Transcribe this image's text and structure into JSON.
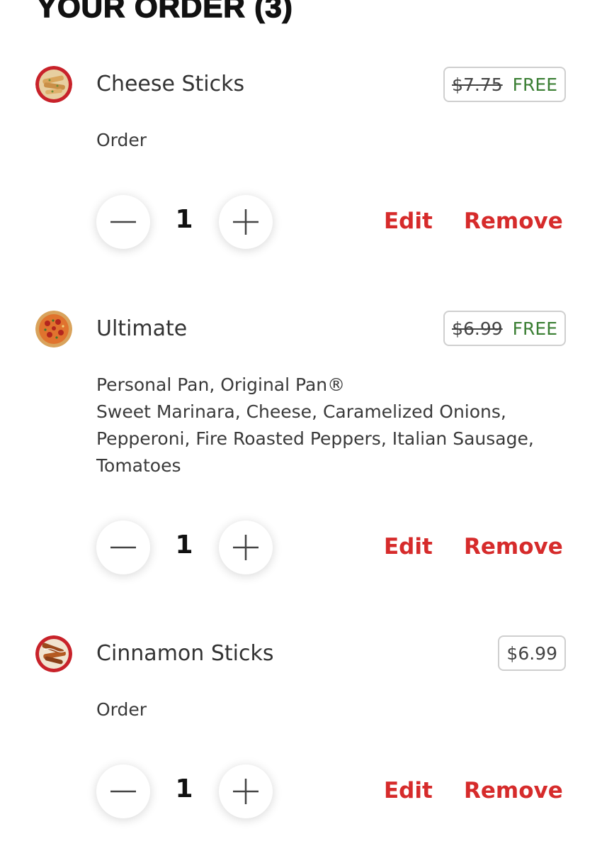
{
  "order": {
    "title": "YOUR ORDER (3)"
  },
  "items": [
    {
      "name": "Cheese Sticks",
      "original_price": "$7.75",
      "price_label": "FREE",
      "details": [
        "Order"
      ],
      "quantity": "1",
      "edit_label": "Edit",
      "remove_label": "Remove",
      "thumb_icon": "cheese-sticks-icon"
    },
    {
      "name": "Ultimate",
      "original_price": "$6.99",
      "price_label": "FREE",
      "details": [
        "Personal Pan, Original Pan®",
        "Sweet Marinara, Cheese, Caramelized Onions,",
        "Pepperoni, Fire Roasted Peppers, Italian Sausage,",
        "Tomatoes"
      ],
      "quantity": "1",
      "edit_label": "Edit",
      "remove_label": "Remove",
      "thumb_icon": "pizza-icon"
    },
    {
      "name": "Cinnamon Sticks",
      "price": "$6.99",
      "details": [
        "Order"
      ],
      "quantity": "1",
      "edit_label": "Edit",
      "remove_label": "Remove",
      "thumb_icon": "cinnamon-sticks-icon"
    }
  ],
  "colors": {
    "accent_red": "#d62b2b",
    "free_green": "#3b7f34",
    "text": "#333333",
    "border": "#cfcfcf"
  }
}
